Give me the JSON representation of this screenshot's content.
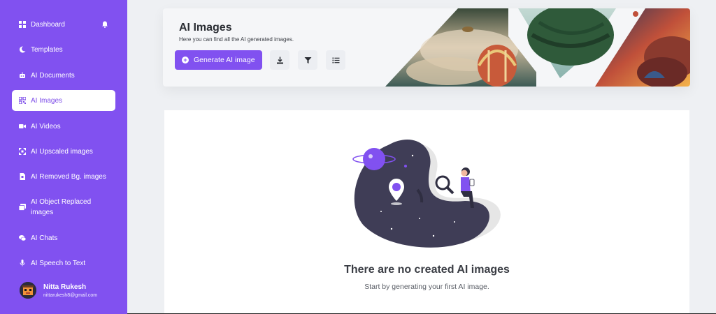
{
  "sidebar": {
    "items": [
      {
        "label": "Dashboard",
        "icon": "dashboard-icon"
      },
      {
        "label": "Templates",
        "icon": "moon-icon"
      },
      {
        "label": "AI Documents",
        "icon": "robot-icon"
      },
      {
        "label": "AI Images",
        "icon": "qrcode-icon",
        "active": true
      },
      {
        "label": "AI Videos",
        "icon": "video-icon"
      },
      {
        "label": "AI Upscaled images",
        "icon": "upscale-icon"
      },
      {
        "label": "AI Removed Bg. images",
        "icon": "file-icon"
      },
      {
        "label": "AI Object Replaced images",
        "icon": "images-icon"
      },
      {
        "label": "AI Chats",
        "icon": "chat-icon"
      },
      {
        "label": "AI Speech to Text",
        "icon": "microphone-icon"
      }
    ],
    "user": {
      "name": "Nitta Rukesh",
      "email": "nittarukesh8@gmail.com"
    }
  },
  "header": {
    "title": "AI Images",
    "subtitle": "Here you can find all the AI generated images.",
    "generate_label": "Generate AI image",
    "tools": [
      "download-icon",
      "filter-icon",
      "list-icon"
    ]
  },
  "empty_state": {
    "title": "There are no created AI images",
    "subtitle": "Start by generating your first AI image."
  },
  "colors": {
    "accent": "#8151f0",
    "illustration_dark": "#3f3d56"
  }
}
